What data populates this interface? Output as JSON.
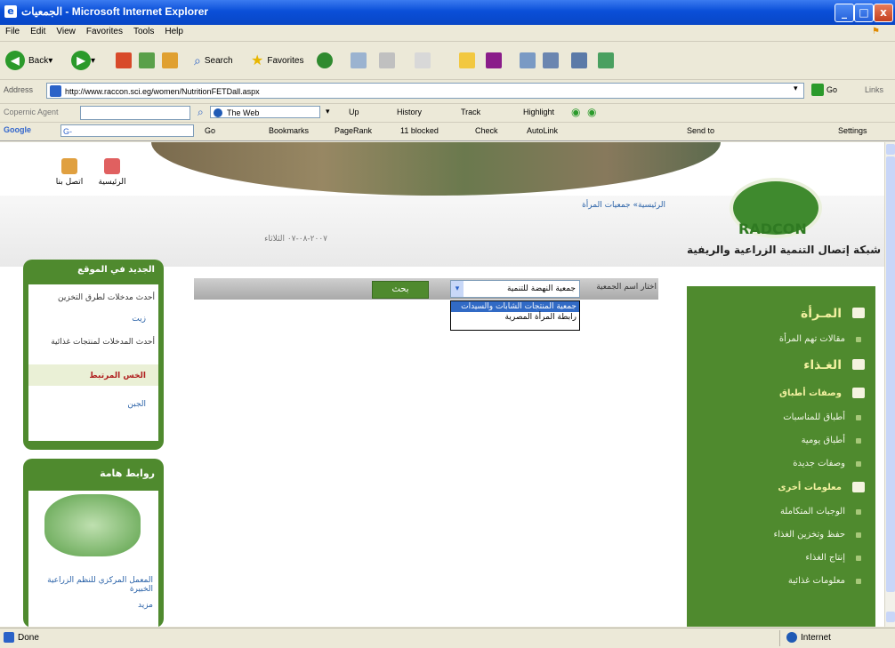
{
  "window": {
    "title": "الجمعيات - Microsoft Internet Explorer",
    "buttons": {
      "minimize": "_",
      "maximize": "□",
      "close": "x"
    }
  },
  "menu": [
    "File",
    "Edit",
    "View",
    "Favorites",
    "Tools",
    "Help"
  ],
  "toolbar": {
    "back": "Back",
    "search": "Search",
    "favorites": "Favorites"
  },
  "address": {
    "label": "Address",
    "url": "http://www.raccon.sci.eg/women/NutritionFETDall.aspx",
    "go": "Go",
    "links": "Links"
  },
  "copernic": {
    "label": "Copernic Agent",
    "the_web": "The Web",
    "up": "Up",
    "history": "History",
    "track": "Track",
    "highlight": "Highlight"
  },
  "google": {
    "label": "Google",
    "input": "G-",
    "go": "Go",
    "bookmarks": "Bookmarks",
    "pagerank": "PageRank",
    "blocked": "11 blocked",
    "check": "Check",
    "autolink": "AutoLink",
    "sendto": "Send to",
    "settings": "Settings"
  },
  "page": {
    "topicons": {
      "home": "الرئيسية",
      "contact": "اتصل بنا"
    },
    "breadcrumb": "الرئيسية» جمعيات المرأة",
    "date": "٢٠٠٧-٠٨-٠٧ الثلاثاء",
    "logo": {
      "text": "RADCON",
      "subtitle": "شبكة إتصال التنمية الزراعية والريفية"
    },
    "search": {
      "label": "اختار اسم الجمعية",
      "selected": "جمعية النهضة للتنمية",
      "button": "بحث",
      "options": [
        "جمعية المنتجات الشابات والسيدات",
        "رابطة المرأة المصرية"
      ]
    },
    "new_box": {
      "title": "الجديد في الموقع",
      "section1": "أحدث مدخلات لطرق التخزين",
      "item1": "زيت",
      "section2": "أحدث المدخلات لمنتجات غذائية",
      "item2": "الخس المرتبط",
      "item3": "الجبن"
    },
    "links_box": {
      "title": "روابط هامة",
      "text": "المعمل المركزي للنظم الزراعية الخبيرة",
      "more": "مزيد"
    },
    "sidemenu": {
      "woman_title": "المـرأة",
      "woman_item": "مقالات تهم المرأة",
      "food_title": "الغـذاء",
      "recipes_title": "وصفات أطباق",
      "recipes": [
        "أطباق للمناسبات",
        "أطباق يومية",
        "وصفات جديدة"
      ],
      "info_title": "معلومات أخرى",
      "info": [
        "الوجبات المتكاملة",
        "حفظ وتخزين الغذاء",
        "إنتاج الغذاء",
        "معلومات غذائية"
      ]
    }
  },
  "status": {
    "text": "Done",
    "zone": "Internet"
  },
  "colors": {
    "titlebar": "#0a4fd8",
    "green": "#4f8a2e",
    "panel": "#ece9d8"
  }
}
